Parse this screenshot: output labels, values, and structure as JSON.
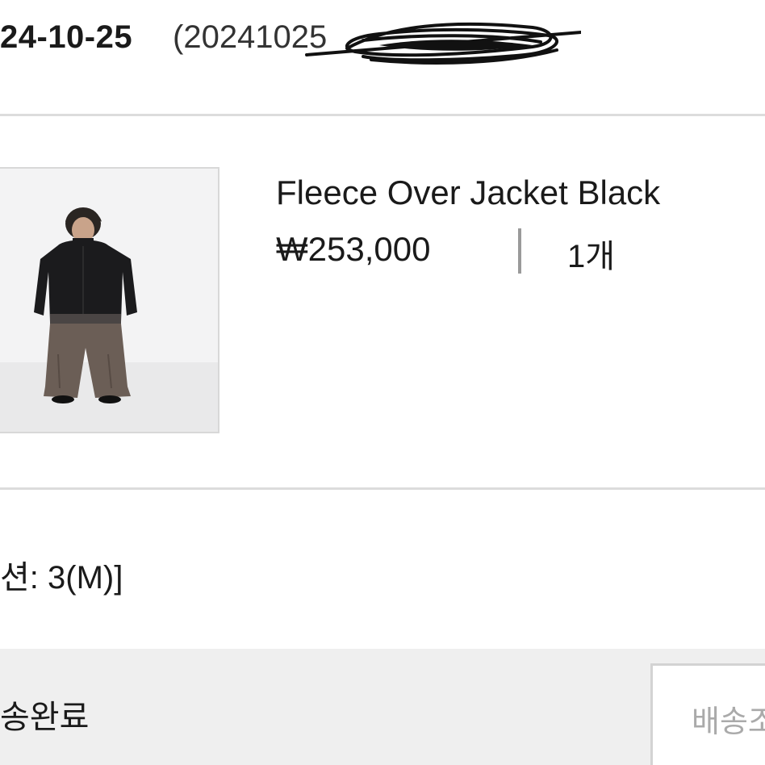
{
  "order": {
    "date": "24-10-25",
    "number_visible": "(20241025"
  },
  "product": {
    "name": "Fleece Over Jacket Black",
    "price": "₩253,000",
    "quantity": "1개",
    "image_alt": "Fleece Over Jacket Black"
  },
  "option": {
    "text": "션: 3(M)]"
  },
  "footer": {
    "status": "송완료",
    "tracking_button_label": "배송조"
  },
  "colors": {
    "divider": "#dcdcdc",
    "footer_bg": "#efefef",
    "button_text": "#aaaaaa"
  }
}
